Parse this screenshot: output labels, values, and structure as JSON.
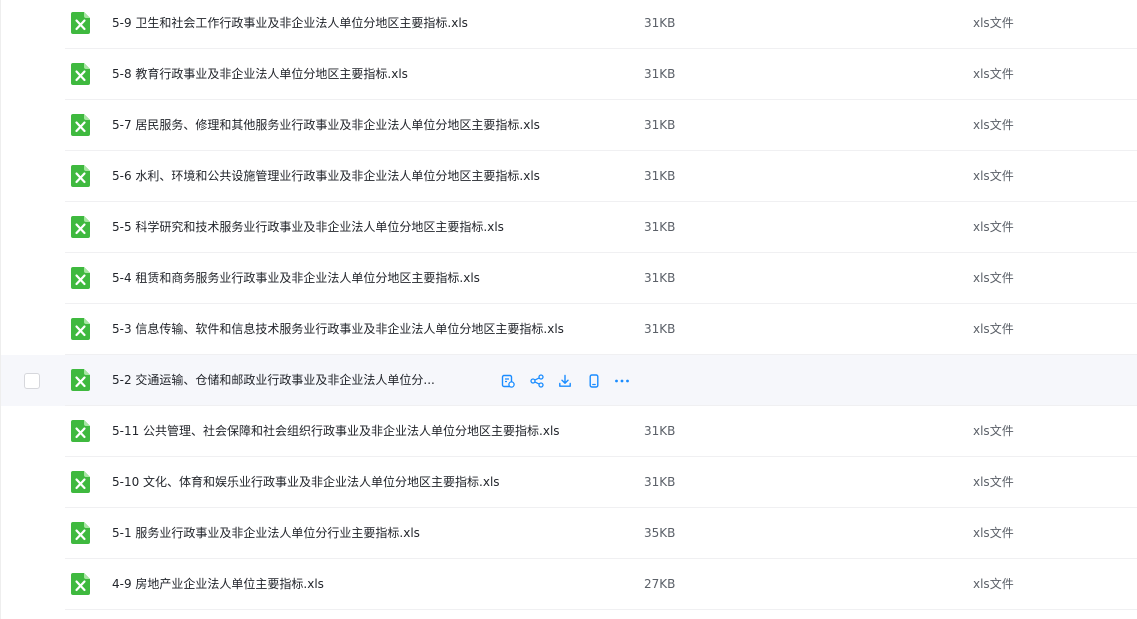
{
  "files": [
    {
      "name": "5-9 卫生和社会工作行政事业及非企业法人单位分地区主要指标.xls",
      "size": "31KB",
      "type": "xls文件"
    },
    {
      "name": "5-8 教育行政事业及非企业法人单位分地区主要指标.xls",
      "size": "31KB",
      "type": "xls文件"
    },
    {
      "name": "5-7 居民服务、修理和其他服务业行政事业及非企业法人单位分地区主要指标.xls",
      "size": "31KB",
      "type": "xls文件"
    },
    {
      "name": "5-6 水利、环境和公共设施管理业行政事业及非企业法人单位分地区主要指标.xls",
      "size": "31KB",
      "type": "xls文件"
    },
    {
      "name": "5-5 科学研究和技术服务业行政事业及非企业法人单位分地区主要指标.xls",
      "size": "31KB",
      "type": "xls文件"
    },
    {
      "name": "5-4 租赁和商务服务业行政事业及非企业法人单位分地区主要指标.xls",
      "size": "31KB",
      "type": "xls文件"
    },
    {
      "name": "5-3 信息传输、软件和信息技术服务业行政事业及非企业法人单位分地区主要指标.xls",
      "size": "31KB",
      "type": "xls文件"
    },
    {
      "name": "5-2 交通运输、仓储和邮政业行政事业及非企业法人单位分...",
      "size": "",
      "type": "",
      "hovered": true
    },
    {
      "name": "5-11 公共管理、社会保障和社会组织行政事业及非企业法人单位分地区主要指标.xls",
      "size": "31KB",
      "type": "xls文件"
    },
    {
      "name": "5-10 文化、体育和娱乐业行政事业及非企业法人单位分地区主要指标.xls",
      "size": "31KB",
      "type": "xls文件"
    },
    {
      "name": "5-1 服务业行政事业及非企业法人单位分行业主要指标.xls",
      "size": "35KB",
      "type": "xls文件"
    },
    {
      "name": "4-9 房地产业企业法人单位主要指标.xls",
      "size": "27KB",
      "type": "xls文件"
    }
  ],
  "hover_actions": [
    "save-to-drive-icon",
    "share-icon",
    "download-icon",
    "phone-icon",
    "more-icon"
  ],
  "colors": {
    "xls_icon": "#3fb93f",
    "action_icon": "#1a8cff",
    "hover_row": "#f6f7fb"
  }
}
